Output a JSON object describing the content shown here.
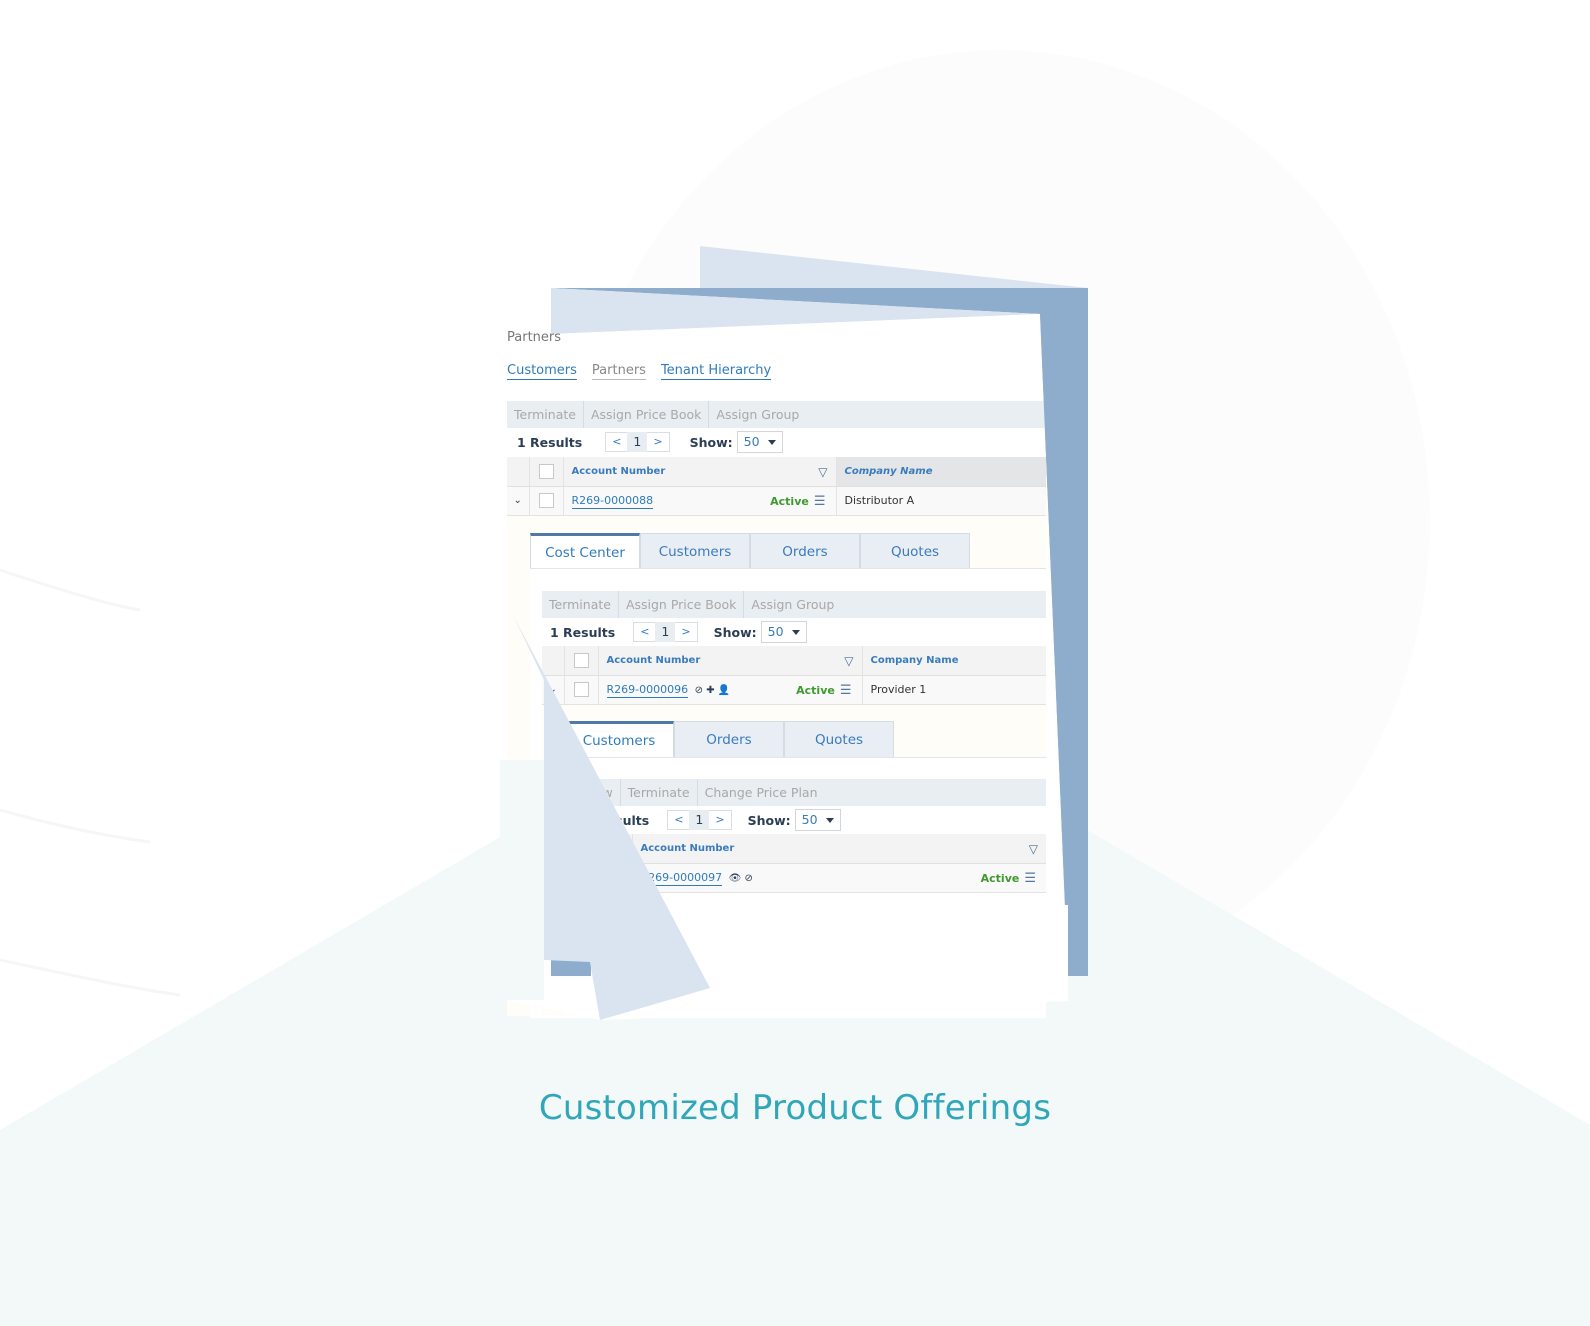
{
  "colors": {
    "background": "#ffffff",
    "background_floor": "#f3f8f9",
    "paper_light": "#dae4f0",
    "paper_dark": "#8eaccb",
    "link": "#2f7bbd",
    "status_active": "#3f9a2e",
    "caption": "#2fa6ba"
  },
  "page": {
    "title": "Partners",
    "nav": [
      {
        "label": "Customers",
        "state": "link"
      },
      {
        "label": "Partners",
        "state": "current"
      },
      {
        "label": "Tenant Hierarchy",
        "state": "link"
      }
    ]
  },
  "level1": {
    "toolbar": [
      "Terminate",
      "Assign Price Book",
      "Assign Group"
    ],
    "results": "1 Results",
    "pager": {
      "prev": "<",
      "page": "1",
      "next": ">"
    },
    "show_label": "Show:",
    "show_value": "50",
    "columns": {
      "account": "Account Number",
      "company": "Company Name"
    },
    "row": {
      "account": "R269-0000088",
      "status": "Active",
      "company": "Distributor A"
    },
    "tabs": [
      "Cost Center",
      "Customers",
      "Orders",
      "Quotes"
    ],
    "active_tab": "Cost Center"
  },
  "level2": {
    "toolbar": [
      "Terminate",
      "Assign Price Book",
      "Assign Group"
    ],
    "results": "1 Results",
    "pager": {
      "prev": "<",
      "page": "1",
      "next": ">"
    },
    "show_label": "Show:",
    "show_value": "50",
    "columns": {
      "account": "Account Number",
      "company": "Company Name"
    },
    "row": {
      "account": "R269-0000096",
      "icons": [
        "ban-icon",
        "plus-icon",
        "add-user-icon"
      ],
      "status": "Active",
      "company": "Provider 1"
    },
    "tabs": [
      "Customers",
      "Orders",
      "Quotes"
    ],
    "active_tab": "Customers"
  },
  "level3": {
    "toolbar": [
      "View",
      "Terminate",
      "Change Price Plan"
    ],
    "results": "1 Results",
    "pager": {
      "prev": "<",
      "page": "1",
      "next": ">"
    },
    "show_label": "Show:",
    "show_value": "50",
    "columns": {
      "account": "Account Number"
    },
    "row": {
      "account": "R269-0000097",
      "icons": [
        "eye-icon",
        "ban-icon"
      ],
      "status": "Active"
    }
  },
  "caption": "Customized Product Offerings"
}
